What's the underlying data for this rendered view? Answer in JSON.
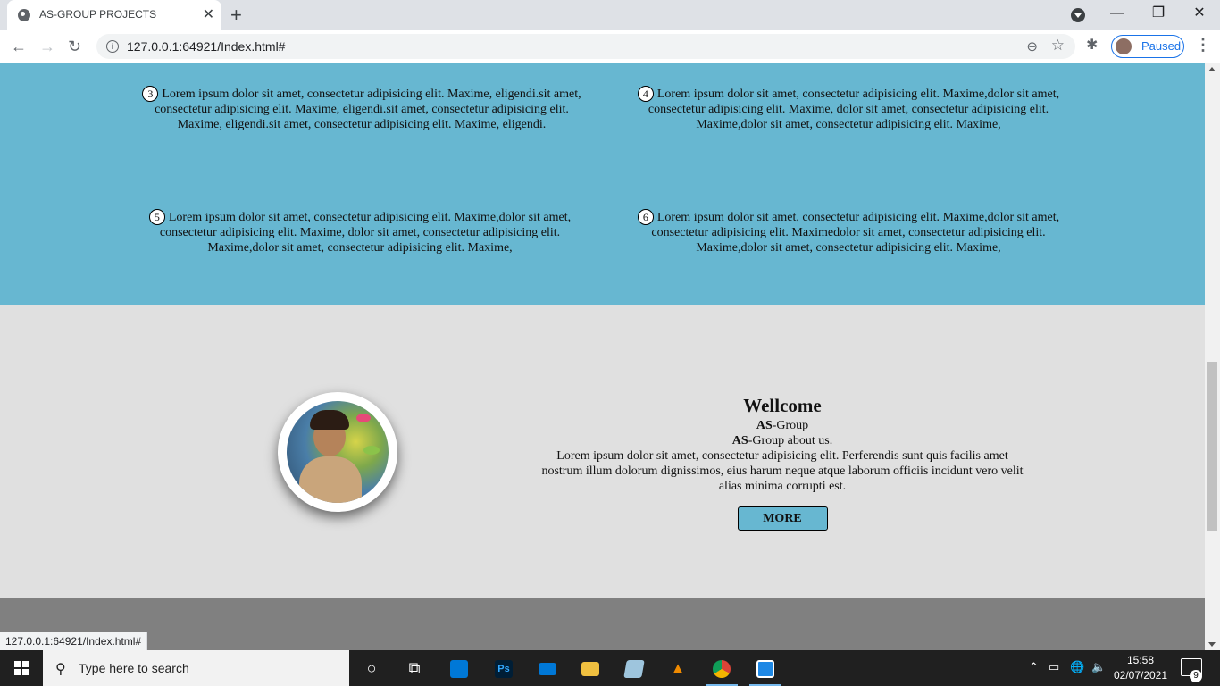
{
  "browser": {
    "tab_title": "AS-GROUP PROJECTS",
    "tab_close": "✕",
    "new_tab": "+",
    "url": "127.0.0.1:64921/Index.html#",
    "profile_label": "Paused",
    "window_controls": {
      "minimize": "—",
      "restore": "❐",
      "close": "✕"
    },
    "nav": {
      "back": "←",
      "forward": "→",
      "reload": "↻",
      "menu": "⋮"
    },
    "icons": {
      "zoom": "⊖",
      "star": "☆",
      "extensions": "✱"
    },
    "status_url": "127.0.0.1:64921/Index.html#"
  },
  "services": [
    {
      "num": "3",
      "text": "Lorem ipsum dolor sit amet, consectetur adipisicing elit. Maxime, eligendi.sit amet, consectetur adipisicing elit. Maxime, eligendi.sit amet, consectetur adipisicing elit. Maxime, eligendi.sit amet, consectetur adipisicing elit. Maxime, eligendi."
    },
    {
      "num": "4",
      "text": "Lorem ipsum dolor sit amet, consectetur adipisicing elit. Maxime,dolor sit amet, consectetur adipisicing elit. Maxime, dolor sit amet, consectetur adipisicing elit. Maxime,dolor sit amet, consectetur adipisicing elit. Maxime,"
    },
    {
      "num": "5",
      "text": "Lorem ipsum dolor sit amet, consectetur adipisicing elit. Maxime,dolor sit amet, consectetur adipisicing elit. Maxime, dolor sit amet, consectetur adipisicing elit. Maxime,dolor sit amet, consectetur adipisicing elit. Maxime,"
    },
    {
      "num": "6",
      "text": "Lorem ipsum dolor sit amet, consectetur adipisicing elit. Maxime,dolor sit amet, consectetur adipisicing elit. Maximedolor sit amet, consectetur adipisicing elit. Maxime,dolor sit amet, consectetur adipisicing elit. Maxime,"
    }
  ],
  "about": {
    "title": "Wellcome",
    "brand_bold": "AS",
    "line1_rest": "-Group",
    "line2_rest": "-Group about us.",
    "text": "Lorem ipsum dolor sit amet, consectetur adipisicing elit. Perferendis sunt quis facilis amet nostrum illum dolorum dignissimos, eius harum neque atque laborum officiis incidunt vero velit alias minima corrupti est.",
    "button": "MORE"
  },
  "taskbar": {
    "search_placeholder": "Type here to search",
    "time": "15:58",
    "date": "02/07/2021",
    "notification_count": "9",
    "photoshop_label": "Ps"
  },
  "colors": {
    "services_bg": "#67b7d1",
    "about_bg": "#e0e0e0",
    "footer_bg": "#808080",
    "button_bg": "#67b7d1"
  }
}
